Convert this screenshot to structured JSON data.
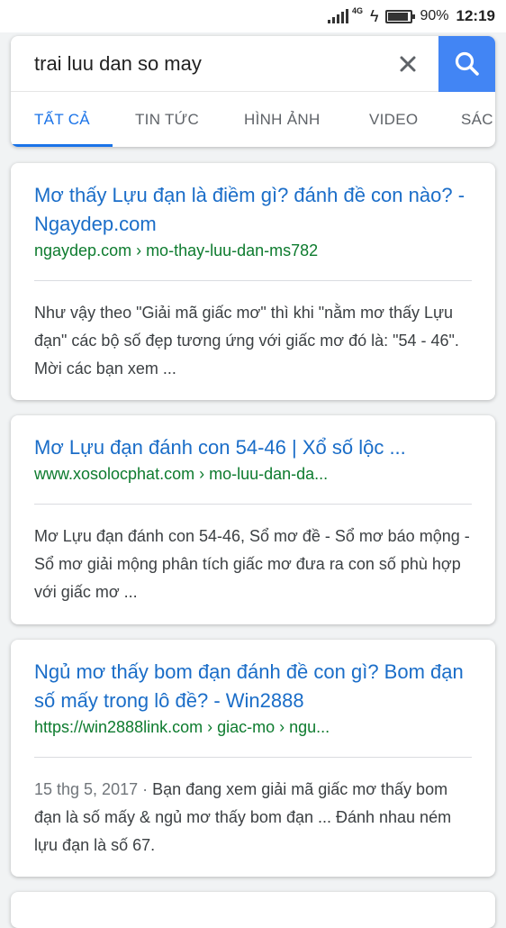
{
  "status_bar": {
    "network": "4G",
    "battery_text": "90%",
    "battery_level": 0.9,
    "time": "12:19"
  },
  "search": {
    "query": "trai luu dan so may",
    "clear_icon": "close-icon",
    "search_icon": "search-icon",
    "accent": "#4285f4"
  },
  "tabs": [
    {
      "label": "TẤT CẢ",
      "active": true
    },
    {
      "label": "TIN TỨC",
      "active": false
    },
    {
      "label": "HÌNH ẢNH",
      "active": false
    },
    {
      "label": "VIDEO",
      "active": false
    },
    {
      "label": "SÁC",
      "active": false
    }
  ],
  "results": [
    {
      "title": "Mơ thấy Lựu đạn là điềm gì? đánh đề con nào? - Ngaydep.com",
      "url": "ngaydep.com › mo-thay-luu-dan-ms782",
      "date": "",
      "snippet": "Như vậy theo \"Giải mã giấc mơ\" thì khi \"nằm mơ thấy Lựu đạn\" các bộ số đẹp tương ứng với giấc mơ đó là: \"54 - 46\". Mời các bạn xem  ..."
    },
    {
      "title": "Mơ Lựu đạn đánh con 54-46 | Xổ số lộc ...",
      "url": "www.xosolocphat.com › mo-luu-dan-da...",
      "date": "",
      "snippet": "Mơ Lựu đạn đánh con 54-46, Sổ mơ đề - Sổ mơ báo mộng - Sổ mơ giải mộng phân tích giấc mơ đưa ra con số phù hợp với giấc mơ ..."
    },
    {
      "title": "Ngủ mơ thấy bom đạn đánh đề con gì? Bom đạn số mấy trong lô đề? - Win2888",
      "url": "https://win2888link.com › giac-mo › ngu...",
      "date": "15 thg 5, 2017 · ",
      "snippet": "Bạn đang xem giải mã giấc mơ thấy bom đạn là số mấy & ngủ mơ thấy bom đạn ... Đánh nhau ném lựu đạn là số 67."
    }
  ]
}
